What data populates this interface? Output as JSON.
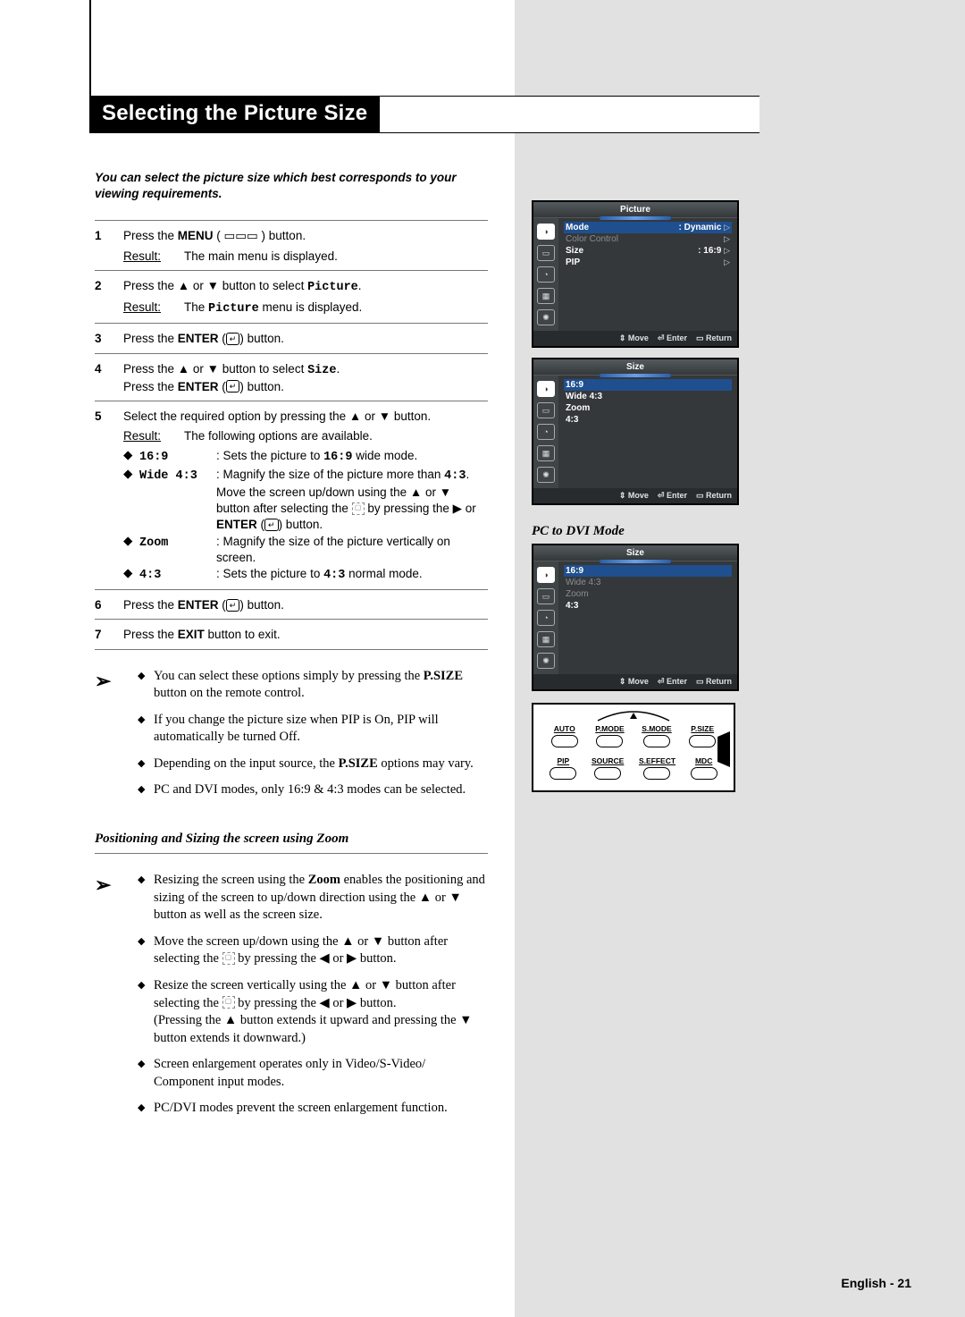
{
  "title": "Selecting the Picture Size",
  "intro": "You can select the picture size which best corresponds to your viewing requirements.",
  "steps": {
    "s1": {
      "n": "1",
      "line1_a": "Press the ",
      "line1_b": "MENU",
      "line1_c": " ( ▭▭▭ ) button.",
      "r_lbl": "Result:",
      "r_txt": "The main menu is displayed."
    },
    "s2": {
      "n": "2",
      "line1": "Press the ▲ or ▼ button to select ",
      "kw": "Picture",
      "tail": ".",
      "r_lbl": "Result:",
      "r_a": "The ",
      "r_kw": "Picture",
      "r_b": " menu is displayed."
    },
    "s3": {
      "n": "3",
      "a": "Press the ",
      "b": "ENTER",
      "c": " (",
      "d": ") button."
    },
    "s4": {
      "n": "4",
      "l1": "Press the ▲ or ▼ button to select ",
      "kw": "Size",
      "l1b": ".",
      "l2a": "Press the ",
      "l2b": "ENTER",
      "l2c": " (",
      "l2d": ") button."
    },
    "s5": {
      "n": "5",
      "l1": "Select the required option by pressing the ▲ or ▼ button.",
      "r_lbl": "Result:",
      "r_txt": "The following options are available.",
      "opts": {
        "o1": {
          "k": "16:9",
          "v": "Sets the picture to ",
          "kw": "16:9",
          "v2": " wide mode."
        },
        "o2": {
          "k": "Wide 4:3",
          "v": "Magnify the size of the picture more than ",
          "kw": "4:3",
          "v2": ".",
          "cont1": "Move the screen up/down using the ▲ or ▼ button after selecting the ",
          "cont2": " by pressing the ▶ or ",
          "cont3": "ENTER",
          "cont4": " (",
          "cont5": ") button."
        },
        "o3": {
          "k": "Zoom",
          "v": "Magnify the size of the picture vertically on screen."
        },
        "o4": {
          "k": "4:3",
          "v": "Sets the picture to ",
          "kw": "4:3",
          "v2": " normal mode."
        }
      }
    },
    "s6": {
      "n": "6",
      "a": "Press the ",
      "b": "ENTER",
      "c": " (",
      "d": ") button."
    },
    "s7": {
      "n": "7",
      "a": "Press the ",
      "b": "EXIT",
      "c": " button to exit."
    }
  },
  "notes1": {
    "n1": {
      "a": "You can select these options simply by pressing the ",
      "b": "P.SIZE",
      "c": " button on the remote control."
    },
    "n2": "If you change the picture size when PIP is On, PIP will automatically be turned Off.",
    "n3": {
      "a": "Depending on the input source, the ",
      "b": "P.SIZE",
      "c": " options may vary."
    },
    "n4": "PC and DVI modes, only 16:9 & 4:3 modes can be selected."
  },
  "zoom_heading": "Positioning and Sizing the screen using Zoom",
  "notes2": {
    "n1": {
      "a": "Resizing the screen using the ",
      "b": "Zoom",
      "c": " enables the positioning and sizing of the screen to up/down direction using the ▲ or ▼ button as well as the screen size."
    },
    "n2": {
      "a": "Move the screen up/down using the ▲ or ▼ button after selecting the ",
      "b": " by pressing the ◀ or ▶ button."
    },
    "n3": {
      "a": "Resize the screen vertically using the ▲ or ▼ button after selecting the ",
      "b": " by pressing the ◀ or ▶ button.",
      "c": "(Pressing the ▲ button extends it upward and pressing the ▼ button extends it downward.)"
    },
    "n4": "Screen enlargement operates only in Video/S-Video/ Component input modes.",
    "n5": "PC/DVI modes prevent the screen enlargement function."
  },
  "osd1": {
    "title": "Picture",
    "rows": {
      "mode_l": "Mode",
      "mode_v": ": Dynamic",
      "cc_l": "Color Control",
      "size_l": "Size",
      "size_v": ": 16:9",
      "pip_l": "PIP"
    },
    "foot": {
      "move": "Move",
      "enter": "Enter",
      "ret": "Return"
    }
  },
  "osd2": {
    "title": "Size",
    "r1": "16:9",
    "r2": "Wide 4:3",
    "r3": "Zoom",
    "r4": "4:3",
    "foot": {
      "move": "Move",
      "enter": "Enter",
      "ret": "Return"
    }
  },
  "pc_label": "PC to DVI Mode",
  "osd3": {
    "title": "Size",
    "r1": "16:9",
    "r2": "Wide 4:3",
    "r3": "Zoom",
    "r4": "4:3",
    "foot": {
      "move": "Move",
      "enter": "Enter",
      "ret": "Return"
    }
  },
  "remote": {
    "r1": [
      "AUTO",
      "P.MODE",
      "S.MODE",
      "P.SIZE"
    ],
    "r2": [
      "PIP",
      "SOURCE",
      "S.EFFECT",
      "MDC"
    ]
  },
  "icons": {
    "enter": "↵",
    "updown": "⇕",
    "ent2": "⏎",
    "ret": "▭"
  },
  "footer": "English - 21"
}
